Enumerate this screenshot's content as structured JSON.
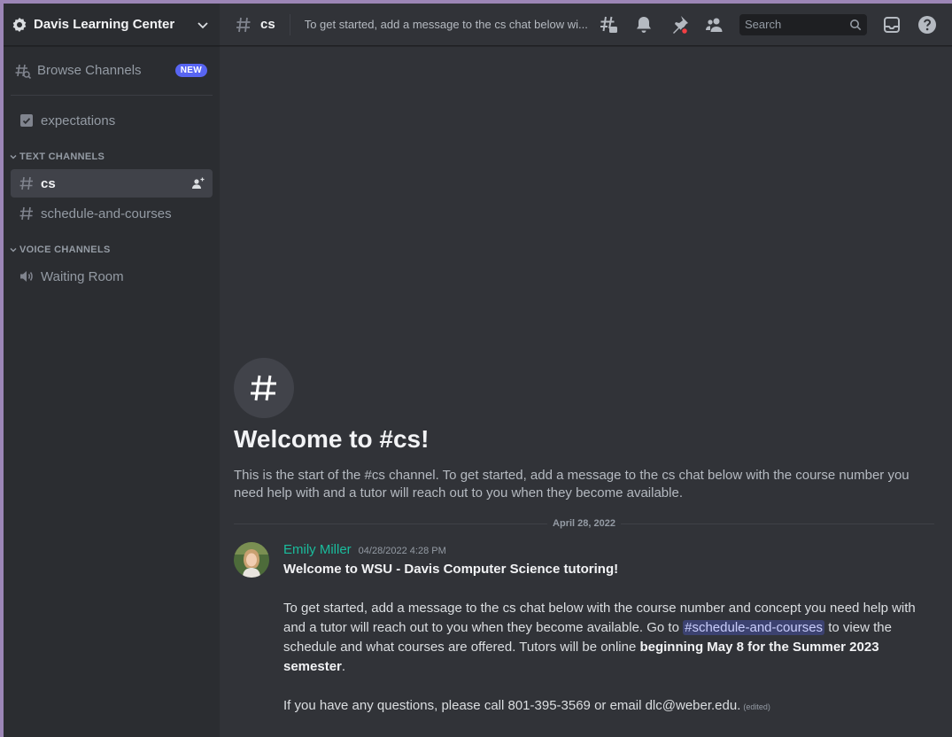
{
  "server": {
    "name": "Davis Learning Center"
  },
  "sidebar": {
    "browse": {
      "label": "Browse Channels",
      "badge": "NEW"
    },
    "expectations": "expectations",
    "text_category": "TEXT CHANNELS",
    "text_channels": [
      {
        "name": "cs"
      },
      {
        "name": "schedule-and-courses"
      }
    ],
    "voice_category": "VOICE CHANNELS",
    "voice_channels": [
      {
        "name": "Waiting Room"
      }
    ]
  },
  "topbar": {
    "channel": "cs",
    "topic": "To get started, add a message to the cs chat below wi...",
    "search_placeholder": "Search"
  },
  "welcome": {
    "title": "Welcome to #cs!",
    "description": "This is the start of the #cs channel. To get started, add a message to the cs chat below with the course number you need help with and a tutor will reach out to you when they become available."
  },
  "date_divider": "April 28, 2022",
  "message": {
    "author": "Emily Miller",
    "timestamp": "04/28/2022 4:28 PM",
    "headline": "Welcome to WSU - Davis Computer Science tutoring!",
    "p1_a": "To get started, add a message to the cs chat below with the course number and concept you need help with and a tutor will reach out to you when they become available. Go to ",
    "p1_mention": "#schedule-and-courses",
    "p1_b": " to view the schedule and what courses are offered. Tutors will be online ",
    "p1_bold": "beginning May 8 for the Summer 2023 semester",
    "p1_c": ".",
    "p2": "If you have any questions, please call 801-395-3569 or email dlc@weber.edu.",
    "edited": "(edited)"
  },
  "colors": {
    "accent": "#5865f2",
    "author": "#1abc9c",
    "mention_bg": "#3c4270",
    "notification_dot": "#f23f43"
  }
}
